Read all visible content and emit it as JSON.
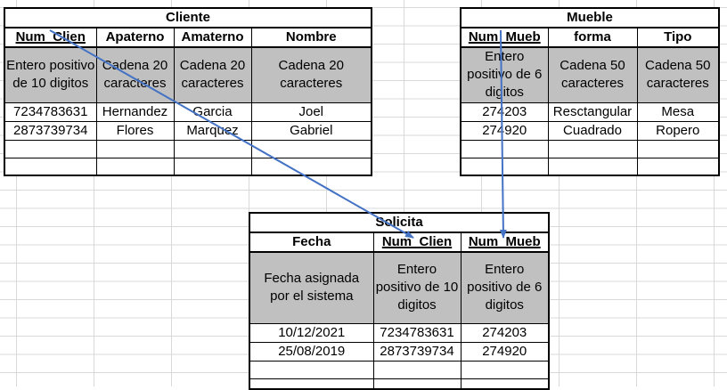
{
  "tables": {
    "cliente": {
      "title": "Cliente",
      "columns": [
        "Num_Clien",
        "Apaterno",
        "Amaterno",
        "Nombre"
      ],
      "types": [
        "Entero positivo de 10 digitos",
        "Cadena 20 caracteres",
        "Cadena 20 caracteres",
        "Cadena 20 caracteres"
      ],
      "rows": [
        [
          "7234783631",
          "Hernandez",
          "Garcia",
          "Joel"
        ],
        [
          "2873739734",
          "Flores",
          "Marquez",
          "Gabriel"
        ]
      ]
    },
    "mueble": {
      "title": "Mueble",
      "columns": [
        "Num_Mueb",
        "forma",
        "Tipo"
      ],
      "types": [
        "Entero positivo de 6 digitos",
        "Cadena 50 caracteres",
        "Cadena 50 caracteres"
      ],
      "rows": [
        [
          "274203",
          "Resctangular",
          "Mesa"
        ],
        [
          "274920",
          "Cuadrado",
          "Ropero"
        ]
      ]
    },
    "solicita": {
      "title": "Solicita",
      "columns": [
        "Fecha",
        "Num_Clien",
        "Num_Mueb"
      ],
      "types": [
        "Fecha asignada por el sistema",
        "Entero positivo de 10 digitos",
        "Entero positivo de 6 digitos"
      ],
      "rows": [
        [
          "10/12/2021",
          "7234783631",
          "274203"
        ],
        [
          "25/08/2019",
          "2873739734",
          "274920"
        ]
      ]
    }
  },
  "colors": {
    "arrow": "#4472c4",
    "header_fill": "#c0c0c0",
    "gridline": "#d9d9d9"
  }
}
